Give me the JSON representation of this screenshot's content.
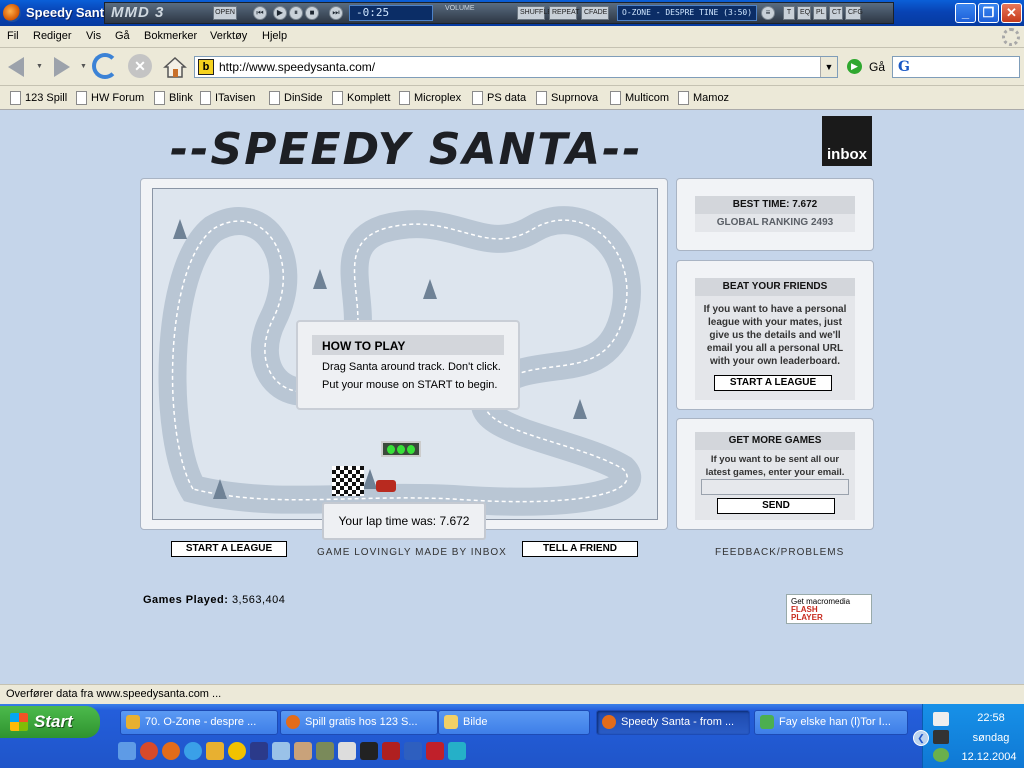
{
  "window": {
    "title": "Speedy Santa"
  },
  "winamp": {
    "logo": "MMD 3",
    "open": "OPEN",
    "time": "-0:25",
    "volume": "VOLUME",
    "shuffle": "SHUFFLE",
    "repeat": "REPEAT",
    "fade": "CFADE",
    "song": "O-ZONE - DESPRE TINE (3:50)",
    "tags": [
      "T",
      "EQ",
      "PL",
      "CT",
      "CFG"
    ]
  },
  "menu": [
    "Fil",
    "Rediger",
    "Vis",
    "Gå",
    "Bokmerker",
    "Verktøy",
    "Hjelp"
  ],
  "nav": {
    "url": "http://www.speedysanta.com/",
    "go_label": "Gå",
    "search_placeholder": ""
  },
  "bookmarks": [
    "123 Spill",
    "HW Forum",
    "Blink",
    "ITavisen",
    "DinSide",
    "Komplett",
    "Microplex",
    "PS data",
    "Suprnova",
    "Multicom",
    "Mamoz"
  ],
  "page": {
    "logo_text": "--SPEEDY SANTA--",
    "inbox_logo": "inbox",
    "howto": {
      "title": "HOW TO PLAY",
      "line1": "Drag Santa around track. Don't click.",
      "line2": "Put your mouse on START to begin."
    },
    "lap_time": "Your lap time was: 7.672",
    "best_time": "BEST TIME: 7.672",
    "global_ranking": "GLOBAL RANKING 2493",
    "beat": {
      "title": "BEAT YOUR FRIENDS",
      "body": "If you want to have a personal league with your mates, just give us the details and we'll email you all a personal URL with your own leaderboard.",
      "button": "START A LEAGUE"
    },
    "more": {
      "title": "GET MORE GAMES",
      "body": "If you want to be sent all our latest games, enter your email.",
      "button": "SEND",
      "email_value": ""
    },
    "start_league_btn": "START A LEAGUE",
    "made_by": "GAME LOVINGLY MADE BY INBOX",
    "tell_friend_btn": "TELL A FRIEND",
    "feedback": "FEEDBACK/PROBLEMS",
    "games_played_label": "Games Played:",
    "games_played_value": "3,563,404",
    "flash": {
      "line1": "Get macromedia",
      "line2": "FLASH",
      "line3": "PLAYER"
    }
  },
  "status": "Overfører data fra www.speedysanta.com ...",
  "taskbar": {
    "start": "Start",
    "tasks": [
      "70. O-Zone - despre ...",
      "Spill gratis hos 123 S...",
      "Bilde",
      "Speedy Santa - from ...",
      "Fay elske han (l)Tor I..."
    ],
    "active_task": 3,
    "clock": "22:58",
    "day": "søndag",
    "date": "12.12.2004"
  },
  "colors": {
    "titlebar": "#0843b4",
    "page_bg": "#c5d5ea",
    "taskbar": "#245edb",
    "start": "#2f932f"
  }
}
